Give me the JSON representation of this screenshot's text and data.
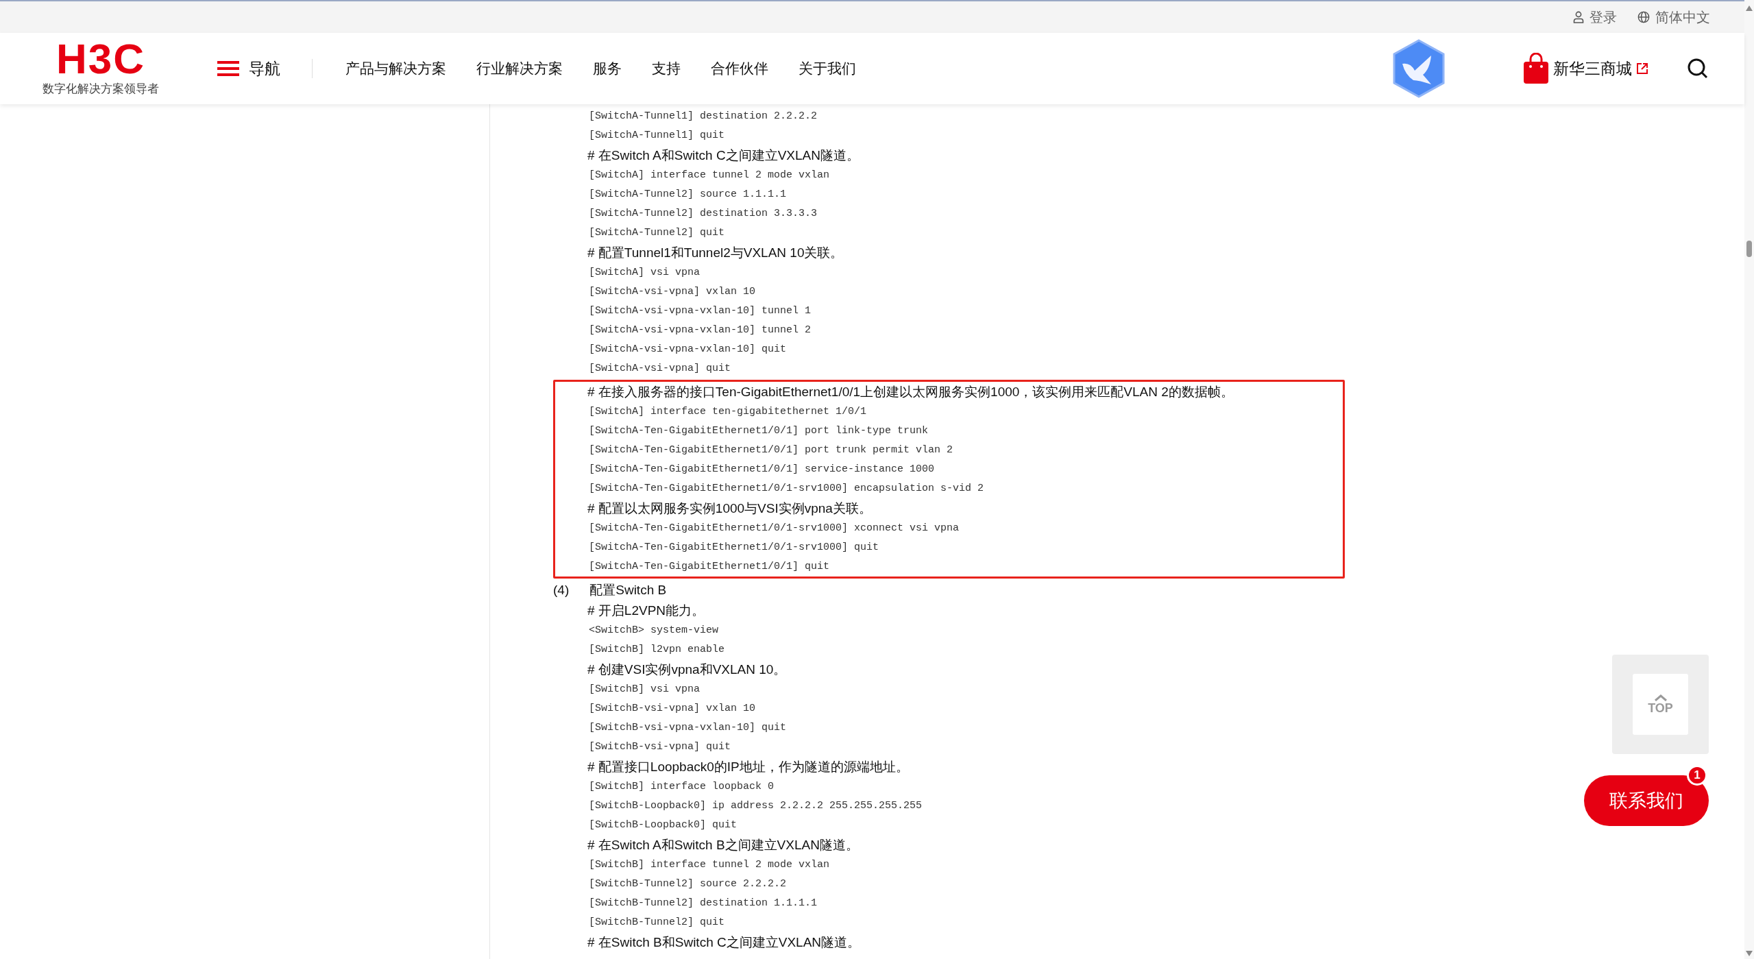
{
  "top_bar": {
    "login": "登录",
    "language": "简体中文"
  },
  "header": {
    "logo": "H3C",
    "tagline": "数字化解决方案领导者",
    "nav_toggle": "导航",
    "menu": [
      "产品与解决方案",
      "行业解决方案",
      "服务",
      "支持",
      "合作伙伴",
      "关于我们"
    ],
    "store": "新华三商城"
  },
  "article": {
    "blocks": [
      {
        "kind": "code",
        "text": "[SwitchA-Tunnel1] destination 2.2.2.2"
      },
      {
        "kind": "code",
        "text": "[SwitchA-Tunnel1] quit"
      },
      {
        "kind": "comment",
        "text": "# 在Switch A和Switch C之间建立VXLAN隧道。"
      },
      {
        "kind": "code",
        "text": "[SwitchA] interface tunnel 2 mode vxlan"
      },
      {
        "kind": "code",
        "text": "[SwitchA-Tunnel2] source 1.1.1.1"
      },
      {
        "kind": "code",
        "text": "[SwitchA-Tunnel2] destination 3.3.3.3"
      },
      {
        "kind": "code",
        "text": "[SwitchA-Tunnel2] quit"
      },
      {
        "kind": "comment",
        "text": "# 配置Tunnel1和Tunnel2与VXLAN 10关联。"
      },
      {
        "kind": "code",
        "text": "[SwitchA] vsi vpna"
      },
      {
        "kind": "code",
        "text": "[SwitchA-vsi-vpna] vxlan 10"
      },
      {
        "kind": "code",
        "text": "[SwitchA-vsi-vpna-vxlan-10] tunnel 1"
      },
      {
        "kind": "code",
        "text": "[SwitchA-vsi-vpna-vxlan-10] tunnel 2"
      },
      {
        "kind": "code",
        "text": "[SwitchA-vsi-vpna-vxlan-10] quit"
      },
      {
        "kind": "code",
        "text": "[SwitchA-vsi-vpna] quit"
      },
      {
        "kind": "highlight",
        "blocks": [
          {
            "kind": "comment",
            "text": "# 在接入服务器的接口Ten-GigabitEthernet1/0/1上创建以太网服务实例1000，该实例用来匹配VLAN 2的数据帧。"
          },
          {
            "kind": "code",
            "text": "[SwitchA] interface ten-gigabitethernet 1/0/1"
          },
          {
            "kind": "code",
            "text": "[SwitchA-Ten-GigabitEthernet1/0/1] port link-type trunk"
          },
          {
            "kind": "code",
            "text": "[SwitchA-Ten-GigabitEthernet1/0/1] port trunk permit vlan 2"
          },
          {
            "kind": "code",
            "text": "[SwitchA-Ten-GigabitEthernet1/0/1] service-instance 1000"
          },
          {
            "kind": "code",
            "text": "[SwitchA-Ten-GigabitEthernet1/0/1-srv1000] encapsulation s-vid 2"
          },
          {
            "kind": "comment",
            "text": "# 配置以太网服务实例1000与VSI实例vpna关联。"
          },
          {
            "kind": "code",
            "text": "[SwitchA-Ten-GigabitEthernet1/0/1-srv1000] xconnect vsi vpna"
          },
          {
            "kind": "code",
            "text": "[SwitchA-Ten-GigabitEthernet1/0/1-srv1000] quit"
          },
          {
            "kind": "code",
            "text": "[SwitchA-Ten-GigabitEthernet1/0/1] quit"
          }
        ]
      },
      {
        "kind": "step",
        "number": "(4)",
        "text": "配置Switch B"
      },
      {
        "kind": "comment",
        "text": "# 开启L2VPN能力。"
      },
      {
        "kind": "code",
        "text": "<SwitchB> system-view"
      },
      {
        "kind": "code",
        "text": "[SwitchB] l2vpn enable"
      },
      {
        "kind": "comment",
        "text": "# 创建VSI实例vpna和VXLAN 10。"
      },
      {
        "kind": "code",
        "text": "[SwitchB] vsi vpna"
      },
      {
        "kind": "code",
        "text": "[SwitchB-vsi-vpna] vxlan 10"
      },
      {
        "kind": "code",
        "text": "[SwitchB-vsi-vpna-vxlan-10] quit"
      },
      {
        "kind": "code",
        "text": "[SwitchB-vsi-vpna] quit"
      },
      {
        "kind": "comment",
        "text": "# 配置接口Loopback0的IP地址，作为隧道的源端地址。"
      },
      {
        "kind": "code",
        "text": "[SwitchB] interface loopback 0"
      },
      {
        "kind": "code",
        "text": "[SwitchB-Loopback0] ip address 2.2.2.2 255.255.255.255"
      },
      {
        "kind": "code",
        "text": "[SwitchB-Loopback0] quit"
      },
      {
        "kind": "comment",
        "text": "# 在Switch A和Switch B之间建立VXLAN隧道。"
      },
      {
        "kind": "code",
        "text": "[SwitchB] interface tunnel 2 mode vxlan"
      },
      {
        "kind": "code",
        "text": "[SwitchB-Tunnel2] source 2.2.2.2"
      },
      {
        "kind": "code",
        "text": "[SwitchB-Tunnel2] destination 1.1.1.1"
      },
      {
        "kind": "code",
        "text": "[SwitchB-Tunnel2] quit"
      },
      {
        "kind": "comment",
        "text": "# 在Switch B和Switch C之间建立VXLAN隧道。"
      }
    ]
  },
  "floating": {
    "top_button": "TOP",
    "contact_button": "联系我们",
    "badge": "1"
  }
}
